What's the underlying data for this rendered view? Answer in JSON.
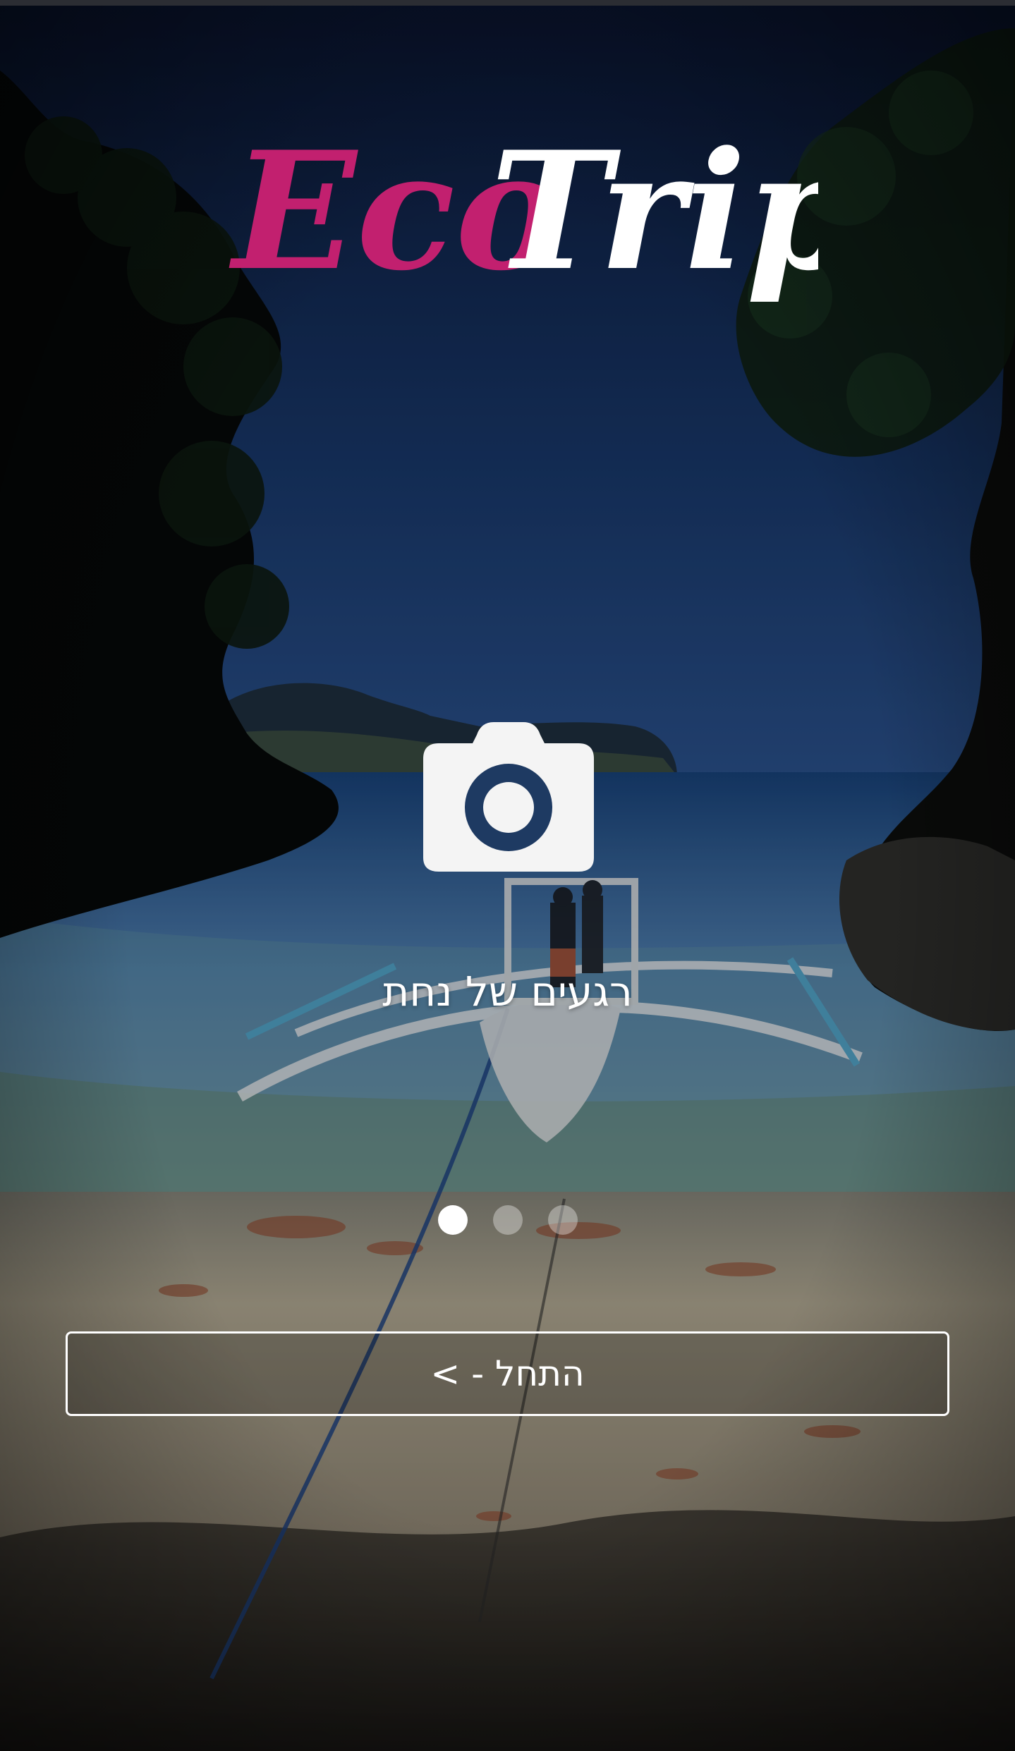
{
  "app": {
    "logo_text_primary": "Eco",
    "logo_text_secondary": "Trip"
  },
  "intro": {
    "tagline": "רגעים של נחת",
    "pager": {
      "total": 3,
      "active_index": 0
    },
    "start_button_label": "התחל - >"
  },
  "icons": {
    "feature_icon": "camera-icon"
  },
  "colors": {
    "logo_pink": "#c2206f",
    "logo_white": "#ffffff",
    "button_border": "#ffffff",
    "text": "#ffffff"
  }
}
